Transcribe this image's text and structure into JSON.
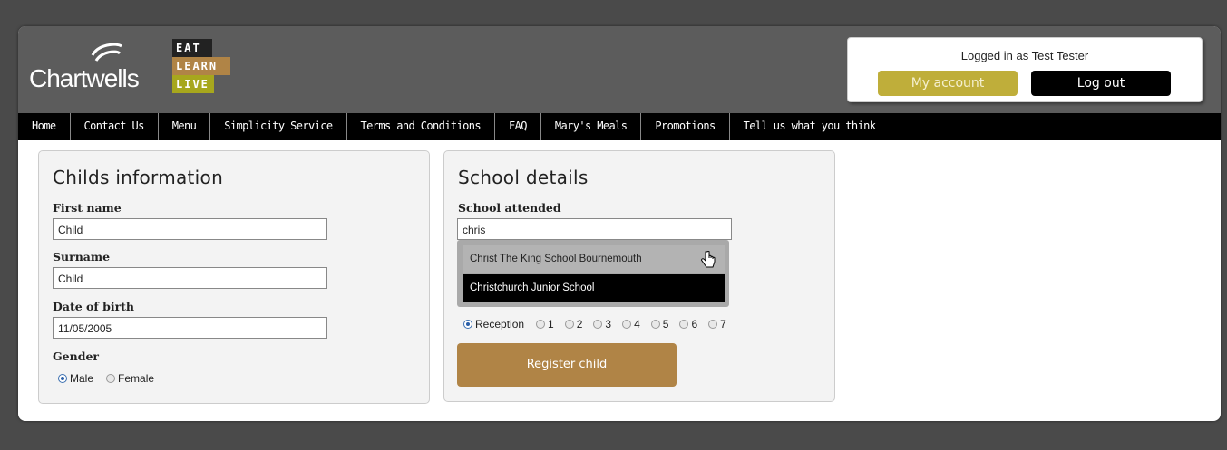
{
  "brand": {
    "name": "Chartwells",
    "tagline": [
      "EAT",
      "LEARN",
      "LIVE"
    ]
  },
  "account": {
    "logged_in": "Logged in as Test Tester",
    "my_account": "My account",
    "log_out": "Log out"
  },
  "nav": {
    "items": [
      "Home",
      "Contact Us",
      "Menu",
      "Simplicity Service",
      "Terms and Conditions",
      "FAQ",
      "Mary's Meals",
      "Promotions",
      "Tell us what you think"
    ]
  },
  "child": {
    "title": "Childs information",
    "first_name_label": "First name",
    "first_name_value": "Child",
    "surname_label": "Surname",
    "surname_value": "Child",
    "dob_label": "Date of birth",
    "dob_value": "11/05/2005",
    "gender_label": "Gender",
    "gender_options": [
      "Male",
      "Female"
    ],
    "gender_selected": "Male"
  },
  "school": {
    "title": "School details",
    "attended_label": "School attended",
    "search_value": "chris",
    "suggestions": [
      "Christ The King School Bournemouth",
      "Christchurch Junior School"
    ],
    "year_options": [
      "Reception",
      "1",
      "2",
      "3",
      "4",
      "5",
      "6",
      "7"
    ],
    "year_selected": "Reception",
    "register_label": "Register child"
  }
}
